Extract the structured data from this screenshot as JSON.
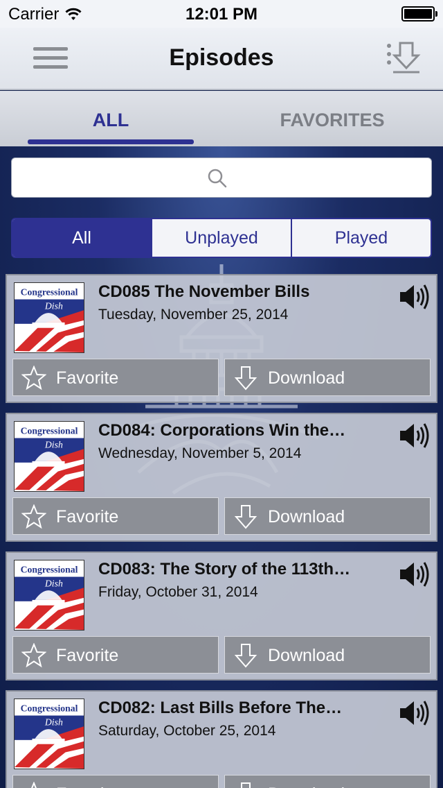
{
  "status_bar": {
    "carrier": "Carrier",
    "time": "12:01 PM"
  },
  "nav": {
    "title": "Episodes",
    "menu_icon": "hamburger-menu-icon",
    "download_icon": "download-queue-icon"
  },
  "tabs": [
    {
      "label": "ALL",
      "active": true
    },
    {
      "label": "FAVORITES",
      "active": false
    }
  ],
  "search": {
    "placeholder": "",
    "icon": "search-icon"
  },
  "filter": {
    "segments": [
      "All",
      "Unplayed",
      "Played"
    ],
    "selected": "All"
  },
  "episodes": [
    {
      "title": "CD085 The November Bills",
      "date": "Tuesday, November 25, 2014",
      "favorite_label": "Favorite",
      "download_label": "Download",
      "art_text_1": "Congressional",
      "art_text_2": "Dish"
    },
    {
      "title": "CD084: Corporations Win the…",
      "date": "Wednesday, November 5, 2014",
      "favorite_label": "Favorite",
      "download_label": "Download",
      "art_text_1": "Congressional",
      "art_text_2": "Dish"
    },
    {
      "title": "CD083: The Story of the 113th…",
      "date": "Friday, October 31, 2014",
      "favorite_label": "Favorite",
      "download_label": "Download",
      "art_text_1": "Congressional",
      "art_text_2": "Dish"
    },
    {
      "title": "CD082: Last Bills Before The…",
      "date": "Saturday, October 25, 2014",
      "favorite_label": "Favorite",
      "download_label": "Download",
      "art_text_1": "Congressional",
      "art_text_2": "Dish"
    }
  ],
  "colors": {
    "accent": "#2e3192",
    "button_bg": "#8c8f96",
    "card_bg": "#c4c8d4"
  }
}
